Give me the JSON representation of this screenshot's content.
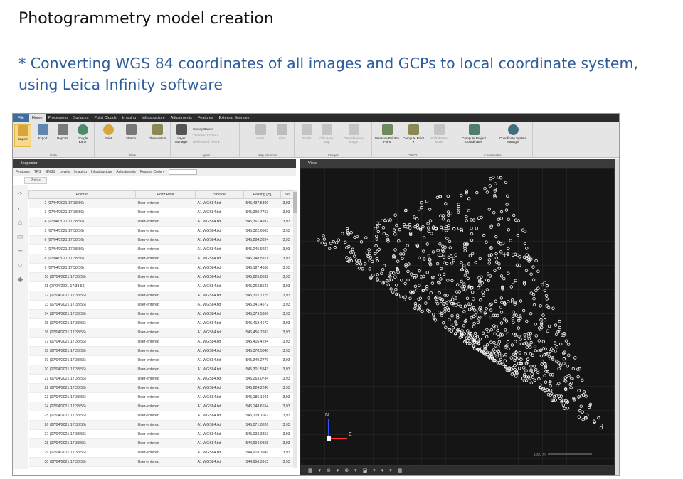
{
  "slide": {
    "title": "Photogrammetry model creation",
    "subtitle": "* Converting WGS 84 coordinates of all images and GCPs to local coordinate system, using Leica Infinity software"
  },
  "menu": [
    "File",
    "Home",
    "Processing",
    "Surfaces",
    "Point Clouds",
    "Imaging",
    "Infrastructure",
    "Adjustments",
    "Features",
    "External Services"
  ],
  "ribbon": {
    "data": {
      "label": "Data",
      "buttons": [
        "Import",
        "Export",
        "Reports",
        "Google Earth"
      ]
    },
    "new": {
      "label": "New",
      "buttons": [
        "Point",
        "Station",
        "Observation"
      ]
    },
    "layers": {
      "label": "Layers",
      "buttons": [
        "Layer Manager"
      ],
      "options": [
        "Survey Data ▾",
        "Thematic Codes ▾",
        "Referenced Files ▾"
      ]
    },
    "map": {
      "label": "Map Services",
      "buttons": [
        "WMS",
        "Live"
      ]
    },
    "images": {
      "label": "Images",
      "buttons": [
        "Switch",
        "Clip Base Map",
        "Georeference Image"
      ]
    },
    "cogo": {
      "label": "COGO",
      "buttons": [
        "Measure Point to Point",
        "Compute Point ▾",
        "Shift Rotate Scale"
      ]
    },
    "coords": {
      "label": "Coordinates",
      "buttons": [
        "Compute Project Coordinates",
        "Coordinate System Manager"
      ]
    }
  },
  "inspector": {
    "title": "Inspector",
    "tabs": [
      "Features",
      "TPS",
      "GNSS",
      "Levels",
      "Imaging",
      "Infrastructure",
      "Adjustments",
      "Feature Code ▾"
    ],
    "breadcrumb": "Points"
  },
  "view": {
    "title": "View",
    "north": "N",
    "east": "E",
    "scale": "1000 m",
    "bottom_tools": [
      "▦ ▾",
      "⊘ ▾",
      "⊕ ▾",
      "◪ ▾",
      "▾ ▾",
      "▦"
    ]
  },
  "table": {
    "headers": [
      "Point Id",
      "Point Role",
      "Source",
      "Easting [m]",
      "No"
    ],
    "rows": [
      [
        "2 (07/04/2021 17:38:56)",
        "User-entered",
        "A1 WGS84.txt",
        "545,437.5399",
        "3,93"
      ],
      [
        "3 (07/04/2021 17:38:56)",
        "User-entered",
        "A1 WGS84.txt",
        "545,399.7753",
        "3,93"
      ],
      [
        "4 (07/04/2021 17:38:56)",
        "User-entered",
        "A1 WGS84.txt",
        "545,361.4932",
        "3,93"
      ],
      [
        "5 (07/04/2021 17:38:56)",
        "User-entered",
        "A1 WGS84.txt",
        "545,322.6083",
        "3,93"
      ],
      [
        "6 (07/04/2021 17:38:56)",
        "User-entered",
        "A1 WGS84.txt",
        "545,284.3324",
        "3,93"
      ],
      [
        "7 (07/04/2021 17:38:56)",
        "User-entered",
        "A1 WGS84.txt",
        "545,245.9227",
        "3,93"
      ],
      [
        "8 (07/04/2021 17:38:56)",
        "User-entered",
        "A1 WGS84.txt",
        "545,148.5811",
        "3,93"
      ],
      [
        "9 (07/04/2021 17:38:56)",
        "User-entered",
        "A1 WGS84.txt",
        "545,187.4658",
        "3,93"
      ],
      [
        "10 (07/04/2021 17:38:56)",
        "User-entered",
        "A1 WGS84.txt",
        "545,225.8632",
        "3,93"
      ],
      [
        "11 (07/04/2021 17:38:56)",
        "User-entered",
        "A1 WGS84.txt",
        "545,263.8543",
        "3,93"
      ],
      [
        "12 (07/04/2021 17:38:56)",
        "User-entered",
        "A1 WGS84.txt",
        "545,302.7175",
        "3,93"
      ],
      [
        "13 (07/04/2021 17:38:56)",
        "User-entered",
        "A1 WGS84.txt",
        "545,341.4572",
        "3,93"
      ],
      [
        "14 (07/04/2021 17:38:56)",
        "User-entered",
        "A1 WGS84.txt",
        "545,379.5366",
        "3,93"
      ],
      [
        "15 (07/04/2021 17:38:56)",
        "User-entered",
        "A1 WGS84.txt",
        "545,418.4672",
        "3,93"
      ],
      [
        "16 (07/04/2021 17:38:56)",
        "User-entered",
        "A1 WGS84.txt",
        "545,456.7937",
        "3,93"
      ],
      [
        "17 (07/04/2021 17:38:56)",
        "User-entered",
        "A1 WGS84.txt",
        "545,416.4294",
        "3,93"
      ],
      [
        "18 (07/04/2021 17:38:56)",
        "User-entered",
        "A1 WGS84.txt",
        "545,378.5040",
        "3,93"
      ],
      [
        "19 (07/04/2021 17:38:56)",
        "User-entered",
        "A1 WGS84.txt",
        "545,340.2779",
        "3,93"
      ],
      [
        "20 (07/04/2021 17:38:56)",
        "User-entered",
        "A1 WGS84.txt",
        "545,301.5843",
        "3,93"
      ],
      [
        "21 (07/04/2021 17:38:56)",
        "User-entered",
        "A1 WGS84.txt",
        "545,263.0784",
        "3,93"
      ],
      [
        "22 (07/04/2021 17:38:56)",
        "User-entered",
        "A1 WGS84.txt",
        "545,224.2240",
        "3,93"
      ],
      [
        "23 (07/04/2021 17:38:56)",
        "User-entered",
        "A1 WGS84.txt",
        "545,186.1941",
        "3,93"
      ],
      [
        "24 (07/04/2021 17:38:56)",
        "User-entered",
        "A1 WGS84.txt",
        "545,148.6554",
        "3,93"
      ],
      [
        "25 (07/04/2021 17:38:56)",
        "User-entered",
        "A1 WGS84.txt",
        "545,109.1067",
        "3,93"
      ],
      [
        "26 (07/04/2021 17:38:56)",
        "User-entered",
        "A1 WGS84.txt",
        "545,071.0826",
        "3,93"
      ],
      [
        "27 (07/04/2021 17:38:56)",
        "User-entered",
        "A1 WGS84.txt",
        "545,032.3353",
        "3,93"
      ],
      [
        "28 (07/04/2021 17:38:56)",
        "User-entered",
        "A1 WGS84.txt",
        "544,994.0865",
        "3,93"
      ],
      [
        "29 (07/04/2021 17:38:56)",
        "User-entered",
        "A1 WGS84.txt",
        "544,918.3949",
        "3,93"
      ],
      [
        "30 (07/04/2021 17:38:56)",
        "User-entered",
        "A1 WGS84.txt",
        "544,956.3915",
        "3,93"
      ]
    ]
  },
  "colors": {
    "accent": "#2e5d9c",
    "menubar": "#2b2b2b",
    "view_bg": "#151515",
    "point": "#ffffff",
    "north": "#3355ff",
    "east": "#ff3333"
  }
}
